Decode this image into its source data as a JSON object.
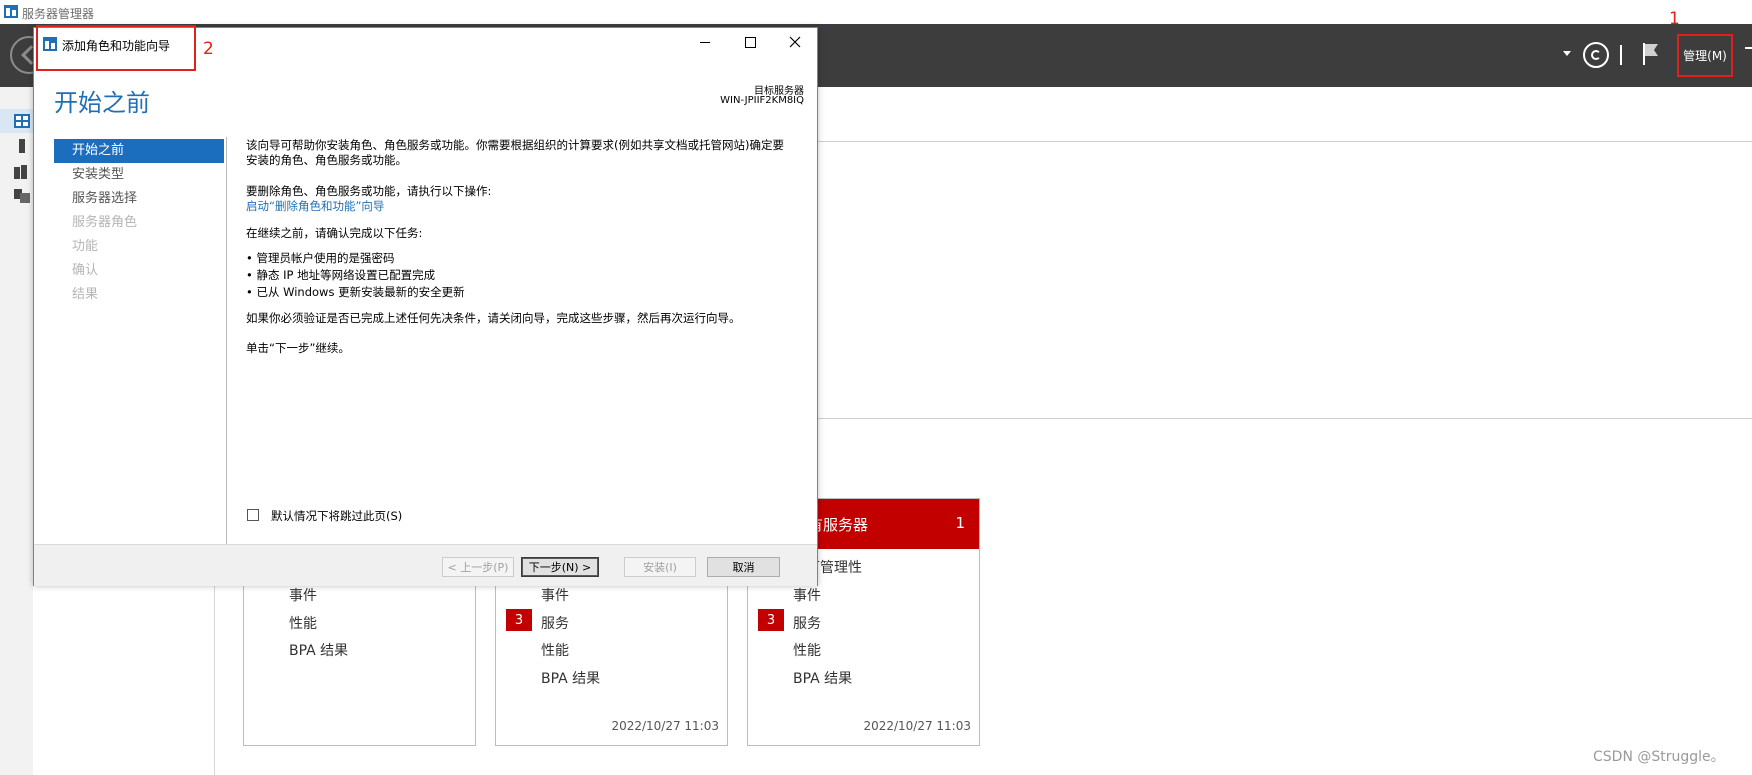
{
  "app": {
    "title": "服务器管理器",
    "manage_label": "管理(M)"
  },
  "annotations": {
    "one": "1",
    "two": "2"
  },
  "tiles": [
    {
      "rows": [
        {
          "label": "事件"
        },
        {
          "label": "性能"
        },
        {
          "label": "BPA 结果"
        }
      ],
      "date": ""
    },
    {
      "rows": [
        {
          "label": "事件"
        },
        {
          "label": "服务",
          "badge": "3"
        },
        {
          "label": "性能"
        },
        {
          "label": "BPA 结果"
        }
      ],
      "date": "2022/10/27 11:03"
    },
    {
      "header_title": "有服务器",
      "header_count": "1",
      "rows": [
        {
          "label": "可管理性"
        },
        {
          "label": "事件"
        },
        {
          "label": "服务",
          "badge": "3"
        },
        {
          "label": "性能"
        },
        {
          "label": "BPA 结果"
        }
      ],
      "date": "2022/10/27 11:03"
    }
  ],
  "watermark": "CSDN @Struggle。",
  "wizard": {
    "title": "添加角色和功能向导",
    "heading": "开始之前",
    "target_label": "目标服务器",
    "target_value": "WIN-JPIIF2KM8IQ",
    "steps": [
      {
        "label": "开始之前",
        "state": "active"
      },
      {
        "label": "安装类型",
        "state": "enabled"
      },
      {
        "label": "服务器选择",
        "state": "enabled"
      },
      {
        "label": "服务器角色",
        "state": "disabled"
      },
      {
        "label": "功能",
        "state": "disabled"
      },
      {
        "label": "确认",
        "state": "disabled"
      },
      {
        "label": "结果",
        "state": "disabled"
      }
    ],
    "intro": "该向导可帮助你安装角色、角色服务或功能。你需要根据组织的计算要求(例如共享文档或托管网站)确定要安装的角色、角色服务或功能。",
    "remove_prompt": "要删除角色、角色服务或功能，请执行以下操作:",
    "remove_link": "启动“删除角色和功能”向导",
    "confirm_prompt": "在继续之前，请确认完成以下任务:",
    "tasks": [
      "管理员帐户使用的是强密码",
      "静态 IP 地址等网络设置已配置完成",
      "已从 Windows 更新安装最新的安全更新"
    ],
    "verify_text": "如果你必须验证是否已完成上述任何先决条件，请关闭向导，完成这些步骤，然后再次运行向导。",
    "continue_text": "单击“下一步”继续。",
    "skip_label": "默认情况下将跳过此页(S)",
    "buttons": {
      "prev": "< 上一步(P)",
      "next": "下一步(N) >",
      "install": "安装(I)",
      "cancel": "取消"
    }
  }
}
